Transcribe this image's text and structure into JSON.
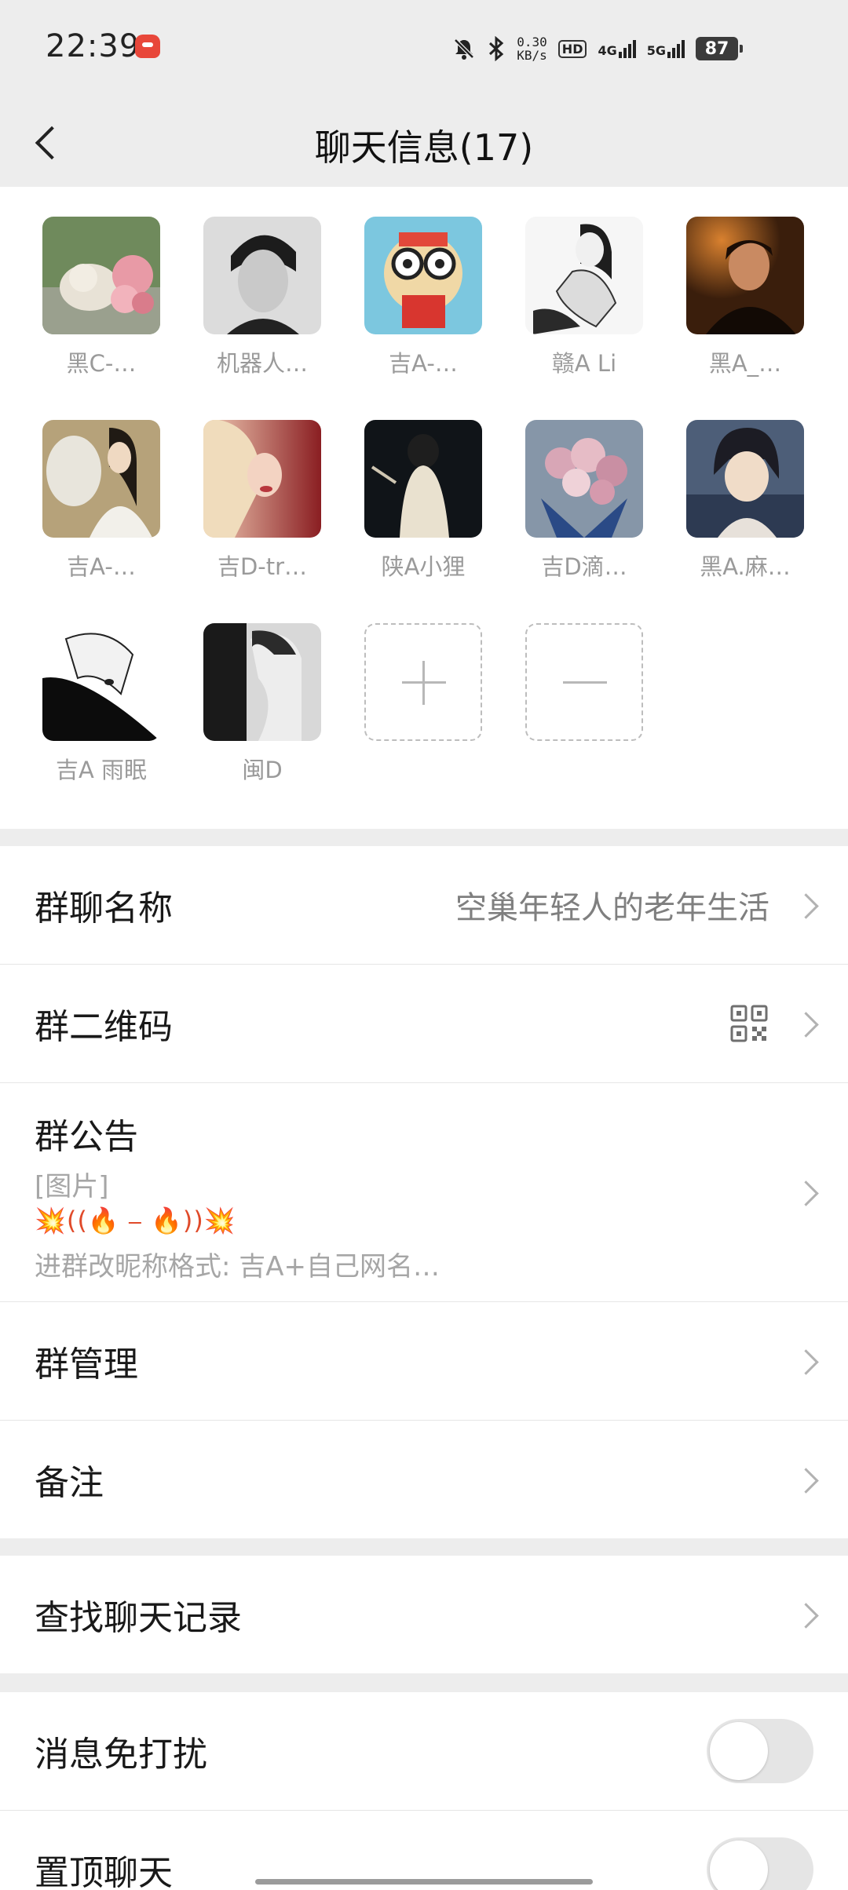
{
  "status_bar": {
    "time": "22:39",
    "speed_value": "0.30",
    "speed_unit": "KB/s",
    "hd_label": "HD",
    "sim1_label": "4G",
    "sim2_label": "5G",
    "battery": "87"
  },
  "header": {
    "title": "聊天信息(17)"
  },
  "members": [
    {
      "name": "黑C-…"
    },
    {
      "name": "机器人…"
    },
    {
      "name": "吉A-…"
    },
    {
      "name": "赣A Li"
    },
    {
      "name": "黑A_…"
    },
    {
      "name": "吉A-…"
    },
    {
      "name": "吉D-tr…"
    },
    {
      "name": "陕A小狸"
    },
    {
      "name": "吉D滴…"
    },
    {
      "name": "黑A.麻…"
    },
    {
      "name": "吉A 雨眠"
    },
    {
      "name": "闽D"
    }
  ],
  "settings": {
    "group_name": {
      "label": "群聊名称",
      "value": "空巢年轻人的老年生活"
    },
    "group_qr": {
      "label": "群二维码"
    },
    "announcement": {
      "label": "群公告",
      "line1": "[图片]",
      "line2": "💥((🔥 ⎯ 🔥))💥",
      "line3": "进群改昵称格式: 吉A+自己网名…"
    },
    "group_manage": {
      "label": "群管理"
    },
    "remark": {
      "label": "备注"
    },
    "search_history": {
      "label": "查找聊天记录"
    },
    "mute": {
      "label": "消息免打扰",
      "enabled": false
    },
    "pin": {
      "label": "置顶聊天",
      "enabled": false
    }
  },
  "colors": {
    "background": "#ededed",
    "row_bg": "#ffffff",
    "muted_text": "#9a9a9a",
    "toggle_off": "#e5e5e5"
  }
}
